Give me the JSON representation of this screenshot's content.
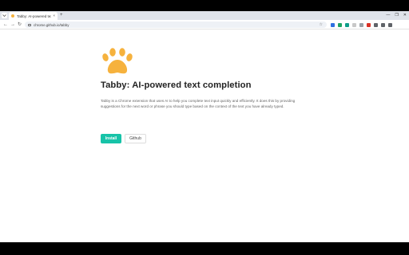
{
  "browser": {
    "tab_title": "Tabby: AI-powered tex",
    "tab_close": "×",
    "new_tab": "+",
    "url": "chrome.github.io/tabby",
    "window_controls": [
      "—",
      "❐",
      "✕"
    ],
    "extension_colors": [
      "#2f6fe0",
      "#1ea362",
      "#0f9d8a",
      "#c8c8c8",
      "#9aa0a6",
      "#d93025",
      "#5f6368",
      "#5f6368",
      "#5f6368"
    ]
  },
  "page": {
    "logo_icon": "paw-icon",
    "logo_color": "#f6b23d",
    "title": "Tabby: AI-powered text completion",
    "description": "Tabby is a Chrome extension that uses AI to help you complete text input quickly and efficiently. It does this by providing suggestions for the next word or phrase you should type based on the context of the text you have already typed.",
    "install_label": "Install",
    "github_label": "Github",
    "accent_color": "#17c3a8"
  }
}
